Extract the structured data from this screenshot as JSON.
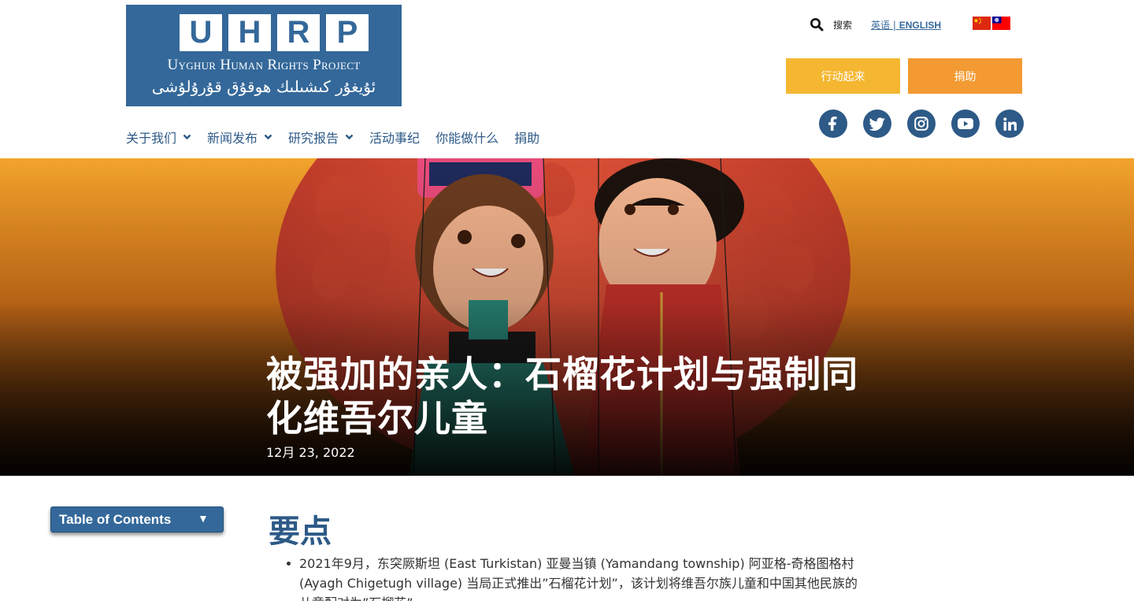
{
  "logo": {
    "letters": [
      "U",
      "H",
      "R",
      "P"
    ],
    "name": "Uyghur Human Rights Project",
    "script": "ئۇيغۇر كىشىلىك ھوقۇق قۇرۇلۇشى"
  },
  "header": {
    "search_label": "搜索",
    "lang_prefix": "英语 | ",
    "lang_english": "ENGLISH",
    "action_button": "行动起来",
    "donate_button": "捐助"
  },
  "social": [
    "facebook-icon",
    "twitter-icon",
    "instagram-icon",
    "youtube-icon",
    "linkedin-icon"
  ],
  "nav": {
    "items": [
      {
        "label": "关于我们",
        "dropdown": true
      },
      {
        "label": "新闻发布",
        "dropdown": true
      },
      {
        "label": "研究报告",
        "dropdown": true
      },
      {
        "label": "活动事纪",
        "dropdown": false
      },
      {
        "label": "你能做什么",
        "dropdown": false
      },
      {
        "label": "捐助",
        "dropdown": false
      }
    ]
  },
  "hero": {
    "title": "被强加的亲人：石榴花计划与强制同化维吾尔儿童",
    "date": "12月 23, 2022"
  },
  "toc": {
    "label": "Table of Contents",
    "arrow": "▼"
  },
  "content": {
    "heading": "要点",
    "bullets": [
      "2021年9月，东突厥斯坦 (East Turkistan) 亚曼当镇 (Yamandang township) 阿亚格-奇格图格村 (Ayagh Chigetugh village) 当局正式推出”石榴花计划”，该计划将维吾尔族儿童和中国其他民族的儿童配对为”石榴花”。"
    ]
  },
  "colors": {
    "brand_blue": "#34689a",
    "nav_blue": "#2d5a87",
    "action_yellow": "#f5b731",
    "donate_orange": "#f39a32"
  }
}
